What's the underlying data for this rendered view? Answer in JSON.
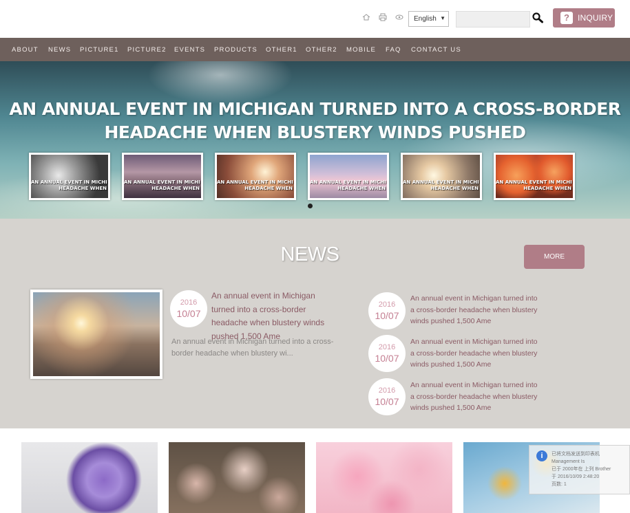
{
  "header": {
    "icons": [
      "home-icon",
      "print-icon",
      "favorite-icon"
    ],
    "language": "English",
    "search_placeholder": "",
    "inquiry_label": "INQUIRY"
  },
  "nav": {
    "items": [
      "ABOUT",
      "NEWS",
      "PICTURE1",
      "PICTURE2",
      "EVENTS",
      "PRODUCTS",
      "OTHER1",
      "OTHER2",
      "MOBILE",
      "FAQ",
      "CONTACT US"
    ]
  },
  "hero": {
    "title_line1": "AN ANNUAL EVENT IN MICHIGAN TURNED INTO A CROSS-BORDER",
    "title_line2": "HEADACHE WHEN BLUSTERY WINDS PUSHED",
    "thumb_caption_line1": "AN ANNUAL EVENT IN MICHI",
    "thumb_caption_line2": "HEADACHE WHEN",
    "thumb_count": 6
  },
  "news": {
    "title": "NEWS",
    "more_label": "MORE",
    "featured": {
      "year": "2016",
      "date": "10/07",
      "headline": "An annual event in Michigan turned into a cross-border headache when blustery winds pushed 1,500 Ame",
      "description": "An annual event in Michigan turned into a cross-border headache when blustery wi..."
    },
    "items": [
      {
        "year": "2016",
        "date": "10/07",
        "text": "An annual event in Michigan turned into a cross-border headache when blustery winds pushed 1,500 Ame"
      },
      {
        "year": "2016",
        "date": "10/07",
        "text": "An annual event in Michigan turned into a cross-border headache when blustery winds pushed 1,500 Ame"
      },
      {
        "year": "2016",
        "date": "10/07",
        "text": "An annual event in Michigan turned into a cross-border headache when blustery winds pushed 1,500 Ame"
      }
    ]
  },
  "popup": {
    "line1": "已将文档发送到印表机",
    "line2": "Management Is",
    "line3": "已于 2000年在 上列 Brother",
    "line4": "于 2016/10/09 2:48:20",
    "line5": "页数: 1"
  }
}
